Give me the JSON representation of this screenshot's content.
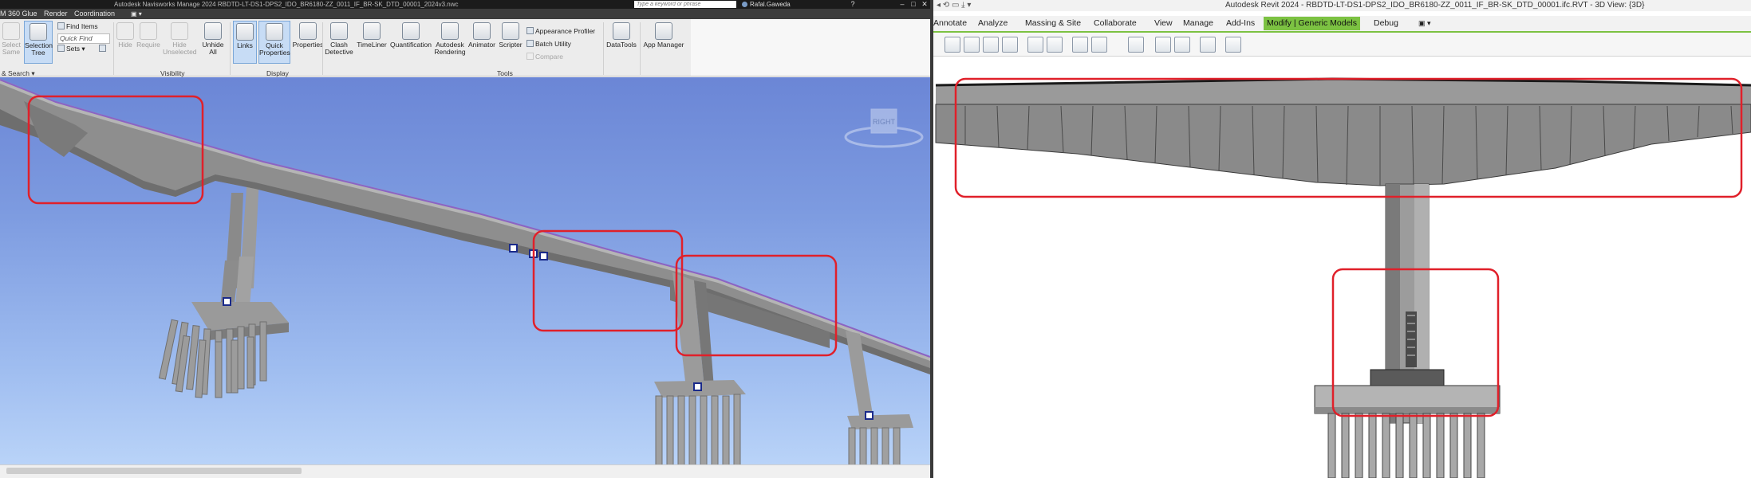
{
  "navisworks": {
    "app_menu": "M 360 Glue",
    "title": "Autodesk Navisworks Manage 2024    RBDTD-LT-DS1-DPS2_IDO_BR6180-ZZ_0011_IF_BR-SK_DTD_00001_2024v3.nwc",
    "search_placeholder": "Type a keyword or phrase",
    "user": "Rafal.Gaweda",
    "tabs": [
      "Render",
      "Coordination"
    ],
    "ribbon": {
      "select_same": "Select Same",
      "selection_tree": "Selection Tree",
      "find_items": "Find Items",
      "quick_find": "Quick Find",
      "sets": "Sets",
      "hide": "Hide",
      "require": "Require",
      "hide_unselected": "Hide Unselected",
      "unhide_all": "Unhide All",
      "links": "Links",
      "quick_properties": "Quick Properties",
      "properties": "Properties",
      "clash_detective": "Clash Detective",
      "timeliner": "TimeLiner",
      "quantification": "Quantification",
      "autodesk_rendering": "Autodesk Rendering",
      "animator": "Animator",
      "scripter": "Scripter",
      "appearance_profiler": "Appearance Profiler",
      "batch_utility": "Batch Utility",
      "compare": "Compare",
      "datatools": "DataTools",
      "app_manager": "App Manager"
    },
    "panels": {
      "select_search": "& Search",
      "visibility": "Visibility",
      "display": "Display",
      "tools": "Tools"
    },
    "viewcube_label": "RIGHT"
  },
  "revit": {
    "title": "Autodesk Revit 2024 - RBDTD-LT-DS1-DPS2_IDO_BR6180-ZZ_0011_IF_BR-SK_DTD_00001.ifc.RVT - 3D View: {3D}",
    "tabs": [
      "Annotate",
      "Analyze",
      "Massing & Site",
      "Collaborate",
      "View",
      "Manage",
      "Add-Ins"
    ],
    "context_tab": "Modify | Generic Models",
    "debug_tab": "Debug"
  },
  "colors": {
    "highlight": "#e0202a",
    "context_tab": "#7cc242",
    "sky_top": "#6b86d6",
    "sky_bottom": "#b9d3f8",
    "concrete": "#8e8e8e"
  }
}
